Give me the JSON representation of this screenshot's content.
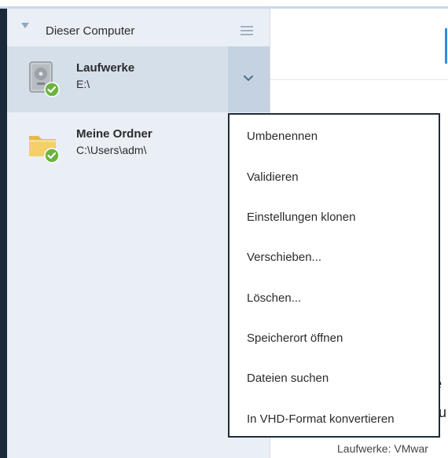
{
  "sidebar": {
    "title": "Dieser Computer",
    "items": [
      {
        "name": "Laufwerke",
        "path": "E:\\",
        "icon": "hard-drive-icon",
        "status": "check-icon",
        "selected": true
      },
      {
        "name": "Meine Ordner",
        "path": "C:\\Users\\adm\\",
        "icon": "folder-icon",
        "status": "check-icon",
        "selected": false
      }
    ]
  },
  "context_menu": {
    "items": [
      "Umbenennen",
      "Validieren",
      "Einstellungen klonen",
      "Verschieben...",
      "Löschen...",
      "Speicherort öffnen",
      "Dateien suchen",
      "In VHD-Format konvertieren"
    ]
  },
  "main": {
    "partial_heading_1": "e",
    "partial_heading_2": "u",
    "footer_text": "Laufwerke: VMwar"
  },
  "colors": {
    "sidebar_bg": "#eaeff5",
    "selected_bg": "#d5dfea",
    "accent": "#3a8ad8",
    "check_green": "#6cb33f"
  }
}
